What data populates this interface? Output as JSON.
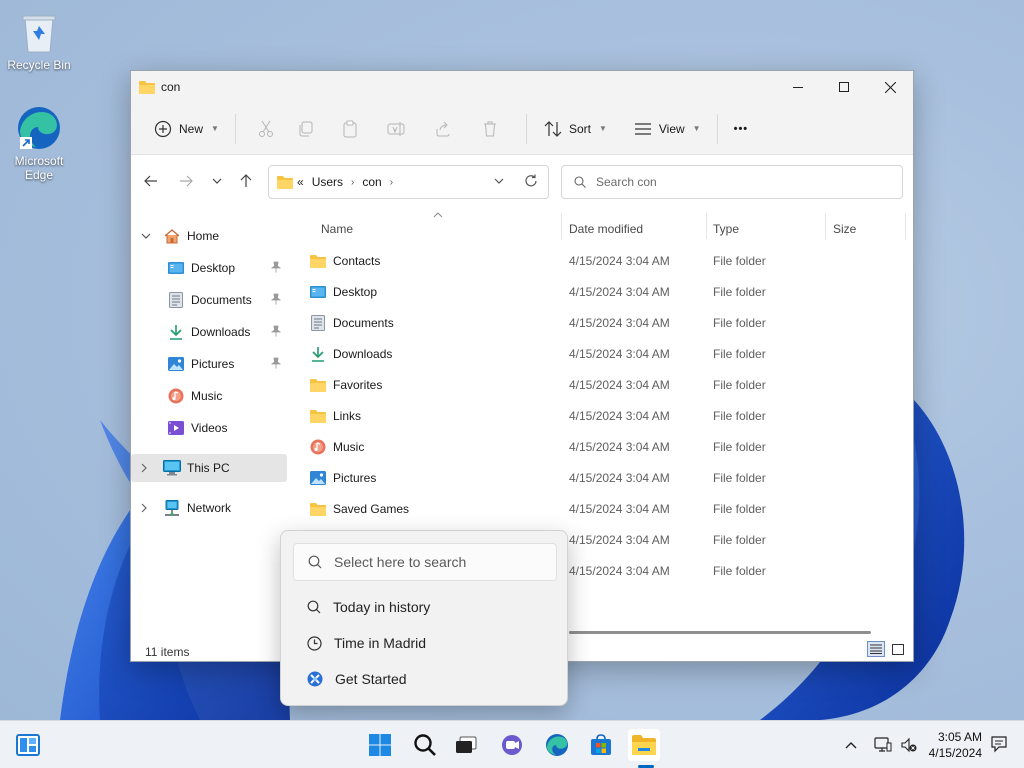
{
  "desktop": {
    "icons": [
      {
        "label": "Recycle Bin",
        "icon": "recycle-bin-icon"
      },
      {
        "label": "Microsoft Edge",
        "icon": "edge-icon"
      }
    ]
  },
  "window": {
    "title": "con",
    "controls": {
      "minimize": "minimize-icon",
      "maximize": "maximize-icon",
      "close": "close-icon"
    },
    "commandbar": {
      "new_label": "New",
      "sort_label": "Sort",
      "view_label": "View",
      "more_label": "•••"
    },
    "address": {
      "overflow": "«",
      "crumbs": [
        "Users",
        "con"
      ]
    },
    "search": {
      "placeholder": "Search con"
    },
    "nav_pane": {
      "home": "Home",
      "quick": [
        {
          "label": "Desktop",
          "icon": "desktop-folder-icon",
          "pinned": true
        },
        {
          "label": "Documents",
          "icon": "documents-folder-icon",
          "pinned": true
        },
        {
          "label": "Downloads",
          "icon": "downloads-folder-icon",
          "pinned": true
        },
        {
          "label": "Pictures",
          "icon": "pictures-folder-icon",
          "pinned": true
        },
        {
          "label": "Music",
          "icon": "music-folder-icon",
          "pinned": false
        },
        {
          "label": "Videos",
          "icon": "videos-folder-icon",
          "pinned": false
        }
      ],
      "this_pc": "This PC",
      "network": "Network"
    },
    "columns": {
      "name": "Name",
      "date": "Date modified",
      "type": "Type",
      "size": "Size"
    },
    "files": [
      {
        "name": "Contacts",
        "date": "4/15/2024 3:04 AM",
        "type": "File folder",
        "icon": "folder-icon"
      },
      {
        "name": "Desktop",
        "date": "4/15/2024 3:04 AM",
        "type": "File folder",
        "icon": "desktop-folder-icon"
      },
      {
        "name": "Documents",
        "date": "4/15/2024 3:04 AM",
        "type": "File folder",
        "icon": "documents-folder-icon"
      },
      {
        "name": "Downloads",
        "date": "4/15/2024 3:04 AM",
        "type": "File folder",
        "icon": "downloads-folder-icon"
      },
      {
        "name": "Favorites",
        "date": "4/15/2024 3:04 AM",
        "type": "File folder",
        "icon": "folder-icon"
      },
      {
        "name": "Links",
        "date": "4/15/2024 3:04 AM",
        "type": "File folder",
        "icon": "folder-icon"
      },
      {
        "name": "Music",
        "date": "4/15/2024 3:04 AM",
        "type": "File folder",
        "icon": "music-folder-icon"
      },
      {
        "name": "Pictures",
        "date": "4/15/2024 3:04 AM",
        "type": "File folder",
        "icon": "pictures-folder-icon"
      },
      {
        "name": "Saved Games",
        "date": "4/15/2024 3:04 AM",
        "type": "File folder",
        "icon": "folder-icon"
      },
      {
        "name": "",
        "date": "4/15/2024 3:04 AM",
        "type": "File folder",
        "icon": "folder-icon"
      },
      {
        "name": "",
        "date": "4/15/2024 3:04 AM",
        "type": "File folder",
        "icon": "folder-icon"
      }
    ],
    "status": "11 items"
  },
  "popup": {
    "search_placeholder": "Select here to search",
    "items": [
      {
        "label": "Today in history",
        "icon": "search-icon"
      },
      {
        "label": "Time in Madrid",
        "icon": "clock-icon"
      },
      {
        "label": "Get Started",
        "icon": "get-started-icon"
      }
    ]
  },
  "taskbar": {
    "apps": [
      "widgets-icon",
      "start-icon",
      "search-icon",
      "task-view-icon",
      "chat-icon",
      "edge-icon",
      "store-icon",
      "file-explorer-icon"
    ],
    "clock_time": "3:05 AM",
    "clock_date": "4/15/2024"
  },
  "colors": {
    "accent": "#0067c0",
    "folder": "#f6c343",
    "selection": "#e5e5e5"
  }
}
